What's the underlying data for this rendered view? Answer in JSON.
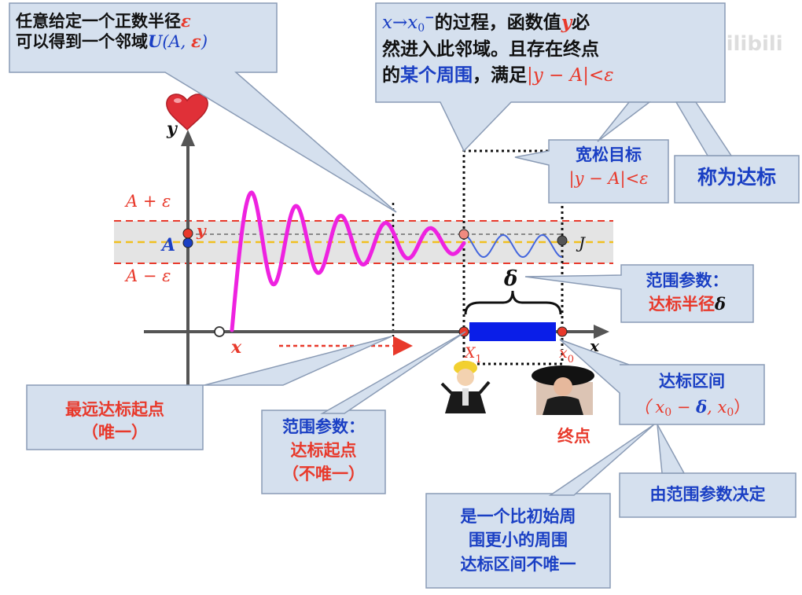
{
  "watermark": "bilibili",
  "callout_top_left": {
    "line1": "任意给定一个正数半径",
    "eps": "ε",
    "line2": "可以得到一个邻域",
    "U": "U",
    "args_a": "(A, ",
    "args_eps": "ε",
    "args_close": ")"
  },
  "callout_top_center": {
    "x": "x",
    "arrow": "→",
    "x0": "x",
    "sub0": "0",
    "sup_minus": "−",
    "t1": "的过程，函数值",
    "y": "y",
    "t2": "必",
    "line2": "然进入此邻域。且存在终点",
    "t3": "的",
    "t4": "某个周围",
    "t5": "，满足",
    "ineq": "|y − A|<ε"
  },
  "callout_loose": {
    "line1": "宽松目标",
    "line2": "|y − A|<ε"
  },
  "callout_reach": "称为达标",
  "callout_radius": {
    "line1": "范围参数：",
    "line2": "达标半径",
    "delta": "δ"
  },
  "callout_interval": {
    "line1": "达标区间",
    "line2a": "（ x",
    "sub0a": "0",
    "line2b": " − ",
    "delta": "δ",
    "line2c": ", x",
    "sub0b": "0",
    "line2d": "）"
  },
  "callout_farthest": {
    "line1": "最远达标起点",
    "line2": "（唯一）"
  },
  "callout_start": {
    "line1": "范围参数：",
    "line2": "达标起点",
    "line3": "（不唯一）"
  },
  "callout_decided": "由范围参数决定",
  "callout_smaller": {
    "line1": "是一个比初始周",
    "line2": "围更小的周围",
    "line3": "达标区间不唯一"
  },
  "label_endpoint": "终点",
  "axis_labels": {
    "y": "y",
    "x_axis": "x",
    "A_plus": "A + ε",
    "A_minus": "A − ε",
    "A": "A",
    "y_mark": "y",
    "J": "J",
    "delta": "δ",
    "x_var": "x",
    "X1": "X",
    "X1_sub": "1",
    "x0": "x",
    "x0_sub": "0"
  },
  "colors": {
    "red": "#e8392b",
    "blue": "#1a3fc4",
    "magenta": "#ee22e0",
    "curve_blue": "#4466dd",
    "band": "#e4e4e4",
    "callout_fill": "#d5e0ee",
    "callout_stroke": "#8a9bb5",
    "interval_bar": "#0a1ee8"
  },
  "icons": [
    "heart-icon",
    "character-figure-icon",
    "lady-figure-icon"
  ]
}
